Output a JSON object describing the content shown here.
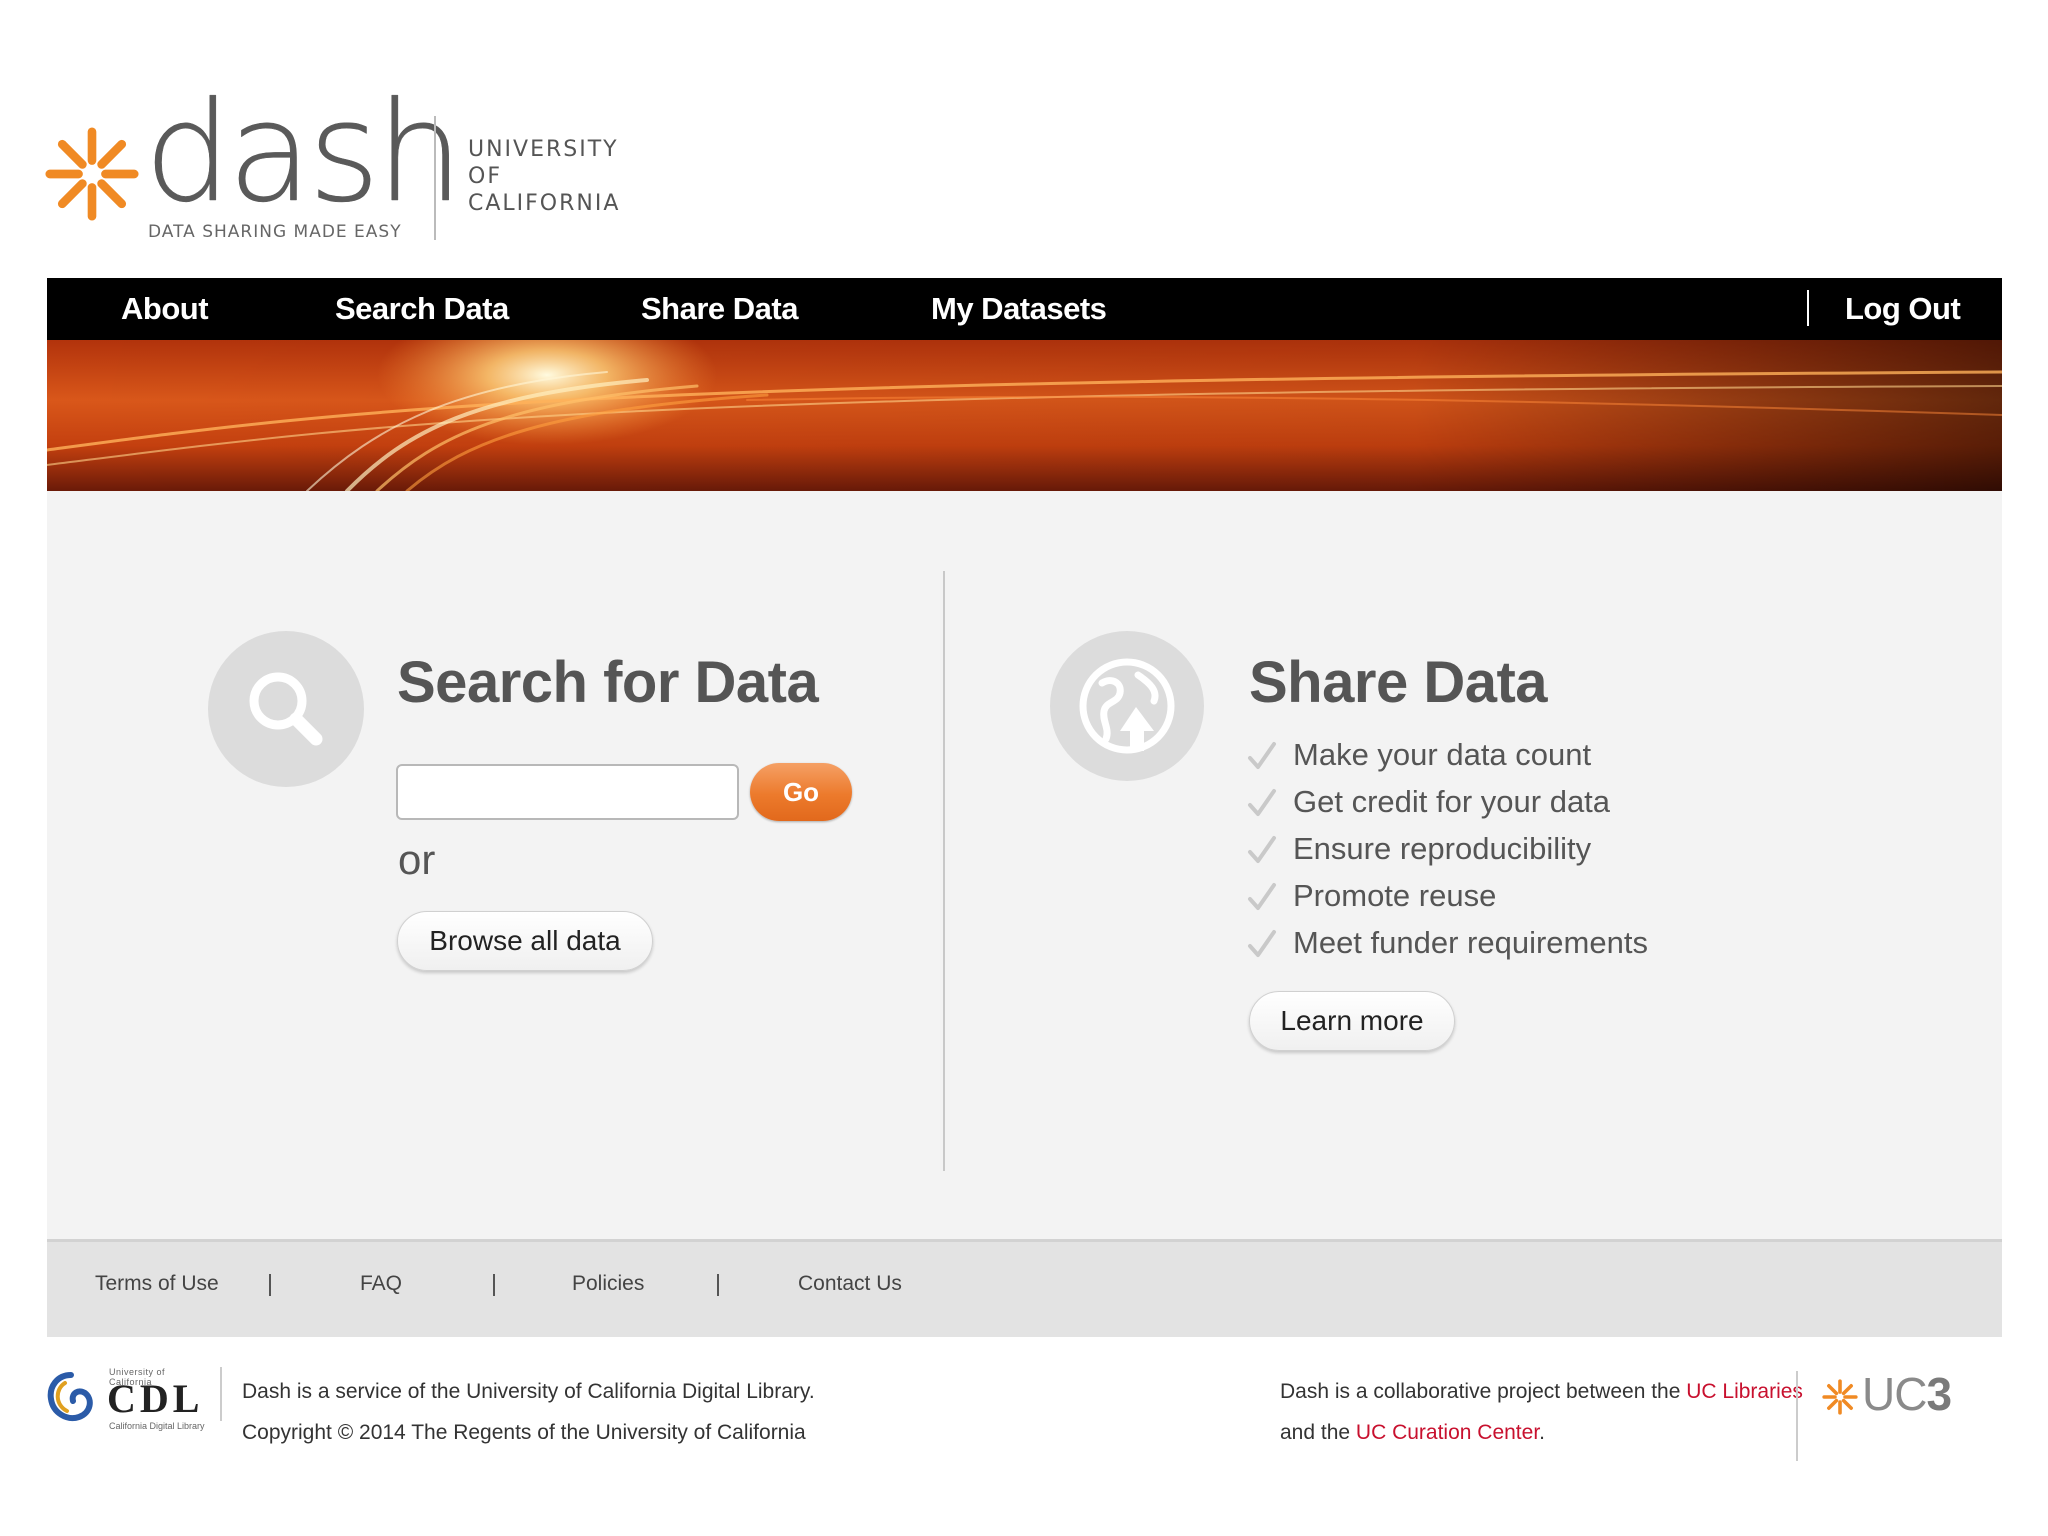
{
  "header": {
    "logo_word": "dash",
    "logo_tagline": "DATA SHARING MADE EASY",
    "university_lines": [
      "UNIVERSITY",
      "OF",
      "CALIFORNIA"
    ]
  },
  "nav": {
    "items": [
      {
        "label": "About"
      },
      {
        "label": "Search Data"
      },
      {
        "label": "Share Data"
      },
      {
        "label": "My Datasets"
      }
    ],
    "logout_label": "Log Out"
  },
  "search": {
    "title": "Search for Data",
    "input_value": "",
    "input_placeholder": "",
    "go_label": "Go",
    "or_text": "or",
    "browse_label": "Browse all data"
  },
  "share": {
    "title": "Share Data",
    "benefits": [
      "Make your data count",
      "Get credit for your data",
      "Ensure reproducibility",
      "Promote reuse",
      "Meet funder requirements"
    ],
    "learn_more_label": "Learn more"
  },
  "footer_nav": {
    "items": [
      "Terms of Use",
      "FAQ",
      "Policies",
      "Contact Us"
    ],
    "separator": "|"
  },
  "footer": {
    "cdl_logo_text": "CDL",
    "cdl_small_top": "University of California",
    "cdl_small_bottom": "California Digital Library",
    "service_line": "Dash is a service of the University of California Digital Library.",
    "copyright_line": "Copyright © 2014 The Regents of the University of California",
    "collab_prefix": "Dash is a collaborative project between the ",
    "collab_link1": "UC Libraries",
    "collab_mid": "and the ",
    "collab_link2": "UC Curation Center",
    "collab_suffix": ".",
    "uc3_prefix": "UC",
    "uc3_number": "3"
  },
  "colors": {
    "brand_orange": "#ec7a2c",
    "nav_black": "#000000",
    "link_red": "#c8102e",
    "panel_gray": "#f3f3f3"
  },
  "icons": {
    "search_section": "magnifier-icon",
    "share_section": "globe-upload-icon",
    "check": "checkmark-icon",
    "logo": "sunburst-icon"
  }
}
